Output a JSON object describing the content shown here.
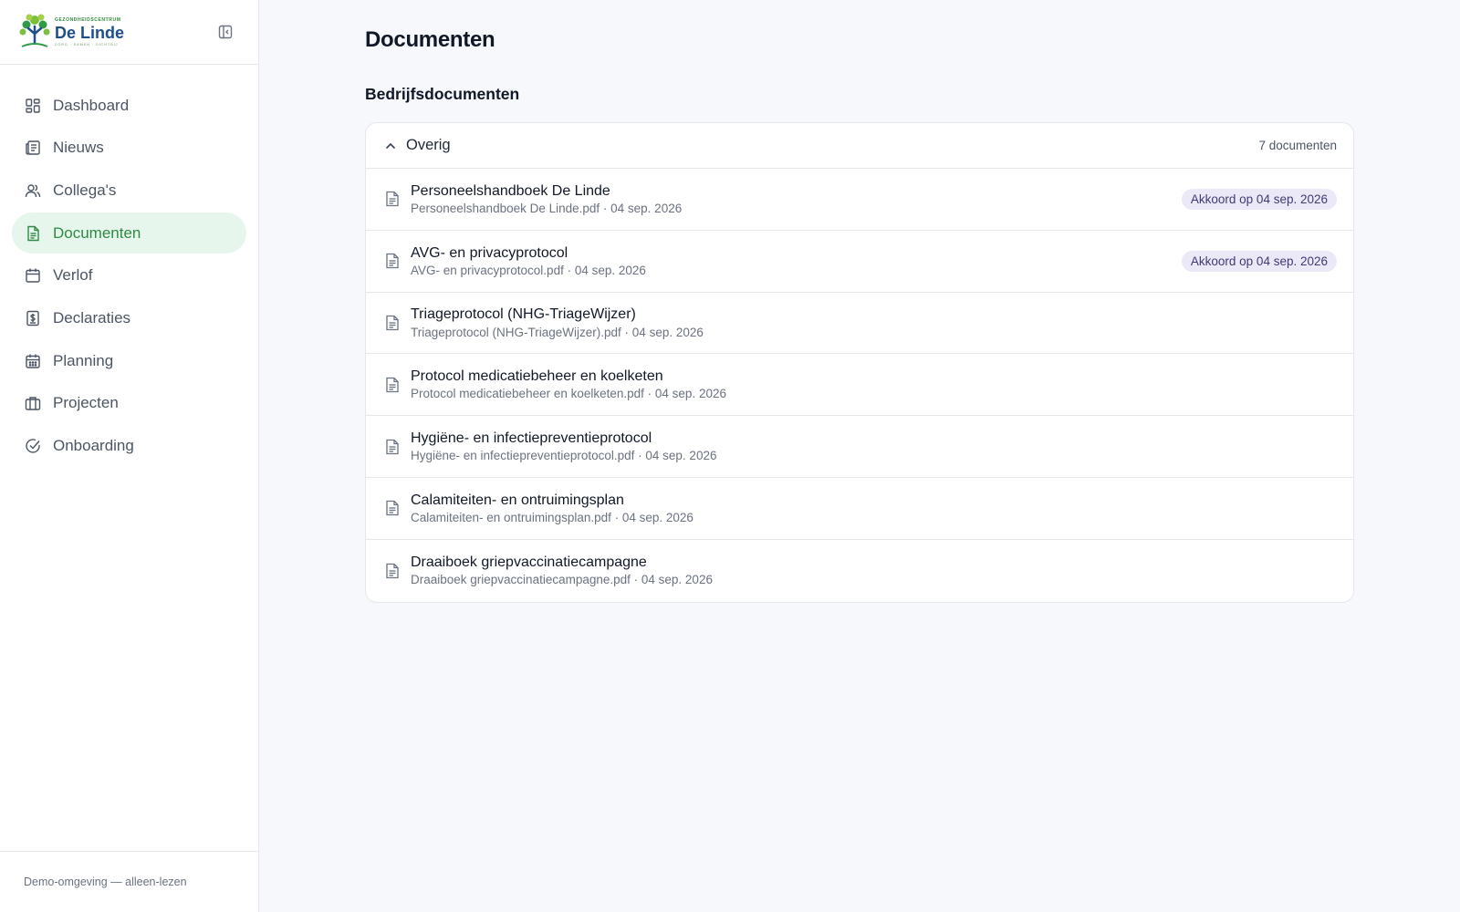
{
  "brand": {
    "top_text": "GEZONDHEIDSCENTRUM",
    "name": "De Linde",
    "tagline": "ZORG · SAMEN · DICHTBIJ"
  },
  "sidebar": {
    "items": [
      {
        "label": "Dashboard",
        "icon": "grid-icon"
      },
      {
        "label": "Nieuws",
        "icon": "newspaper-icon"
      },
      {
        "label": "Collega's",
        "icon": "users-icon"
      },
      {
        "label": "Documenten",
        "icon": "file-text-icon",
        "active": true
      },
      {
        "label": "Verlof",
        "icon": "calendar-icon"
      },
      {
        "label": "Declaraties",
        "icon": "receipt-icon"
      },
      {
        "label": "Planning",
        "icon": "calendar-grid-icon"
      },
      {
        "label": "Projecten",
        "icon": "briefcase-icon"
      },
      {
        "label": "Onboarding",
        "icon": "check-circle-icon"
      }
    ],
    "footer": "Demo-omgeving — alleen-lezen"
  },
  "main": {
    "title": "Documenten",
    "section_title": "Bedrijfsdocumenten",
    "group": {
      "title": "Overig",
      "count": "7 documenten",
      "documents": [
        {
          "title": "Personeelshandboek De Linde",
          "meta": "Personeelshandboek De Linde.pdf · 04 sep. 2026",
          "badge": "Akkoord op 04 sep. 2026"
        },
        {
          "title": "AVG- en privacyprotocol",
          "meta": "AVG- en privacyprotocol.pdf · 04 sep. 2026",
          "badge": "Akkoord op 04 sep. 2026"
        },
        {
          "title": "Triageprotocol (NHG-TriageWijzer)",
          "meta": "Triageprotocol (NHG-TriageWijzer).pdf · 04 sep. 2026",
          "badge": ""
        },
        {
          "title": "Protocol medicatiebeheer en koelketen",
          "meta": "Protocol medicatiebeheer en koelketen.pdf · 04 sep. 2026",
          "badge": ""
        },
        {
          "title": "Hygiëne- en infectiepreventieprotocol",
          "meta": "Hygiëne- en infectiepreventieprotocol.pdf · 04 sep. 2026",
          "badge": ""
        },
        {
          "title": "Calamiteiten- en ontruimingsplan",
          "meta": "Calamiteiten- en ontruimingsplan.pdf · 04 sep. 2026",
          "badge": ""
        },
        {
          "title": "Draaiboek griepvaccinatiecampagne",
          "meta": "Draaiboek griepvaccinatiecampagne.pdf · 04 sep. 2026",
          "badge": ""
        }
      ]
    }
  },
  "colors": {
    "accent_green": "#2e8a45",
    "active_bg": "#e7f6ec",
    "badge_bg": "#ebe9f8",
    "badge_text": "#3f3a73"
  }
}
